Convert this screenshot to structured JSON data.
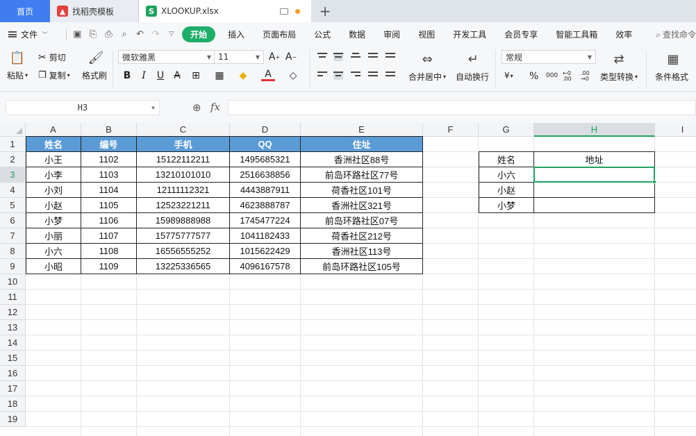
{
  "tabs": {
    "home": "首页",
    "template": "找稻壳模板",
    "file": "XLOOKUP.xlsx",
    "new_tab": "+"
  },
  "menu": {
    "file": "文件",
    "items": [
      "开始",
      "插入",
      "页面布局",
      "公式",
      "数据",
      "审阅",
      "视图",
      "开发工具",
      "会员专享",
      "智能工具箱",
      "效率"
    ],
    "search": "查找命令"
  },
  "ribbon": {
    "paste": "粘贴",
    "cut": "剪切",
    "copy": "复制",
    "format_painter": "格式刷",
    "font_name": "微软雅黑",
    "font_size": "11",
    "merge_center": "合并居中",
    "wrap_text": "自动换行",
    "number_format": "常规",
    "type_convert": "类型转换",
    "cond_format": "条件格式",
    "currency": "¥",
    "percent": "%",
    "thousands": "000",
    "inc_decimal": "←0 .00",
    "dec_decimal": ".00 →0"
  },
  "formula_bar": {
    "name_box": "H3",
    "fx": "fx",
    "value": ""
  },
  "sheet": {
    "columns": [
      "A",
      "B",
      "C",
      "D",
      "E",
      "F",
      "G",
      "H",
      "I"
    ],
    "active_column": "H",
    "rows": [
      "1",
      "2",
      "3",
      "4",
      "5",
      "6",
      "7",
      "8",
      "9",
      "10",
      "11",
      "12",
      "13",
      "14",
      "15",
      "16",
      "17",
      "18",
      "19"
    ],
    "active_row": "3",
    "table1_headers": [
      "姓名",
      "编号",
      "手机",
      "QQ",
      "住址"
    ],
    "table1_rows": [
      [
        "小王",
        "1102",
        "15122112211",
        "1495685321",
        "香洲社区88号"
      ],
      [
        "小李",
        "1103",
        "13210101010",
        "2516638856",
        "前岛环路社区77号"
      ],
      [
        "小刘",
        "1104",
        "12111112321",
        "4443887911",
        "荷香社区101号"
      ],
      [
        "小赵",
        "1105",
        "12523221211",
        "4623888787",
        "香洲社区321号"
      ],
      [
        "小梦",
        "1106",
        "15989888988",
        "1745477224",
        "前岛环路社区07号"
      ],
      [
        "小丽",
        "1107",
        "15775777577",
        "1041182433",
        "荷香社区212号"
      ],
      [
        "小六",
        "1108",
        "16556555252",
        "1015622429",
        "香洲社区113号"
      ],
      [
        "小昭",
        "1109",
        "13225336565",
        "4096167578",
        "前岛环路社区105号"
      ]
    ],
    "table2_headers": [
      "姓名",
      "地址"
    ],
    "table2_rows": [
      [
        "小六",
        ""
      ],
      [
        "小赵",
        ""
      ],
      [
        "小梦",
        ""
      ]
    ],
    "header_color": "#5b9bd5",
    "selection_color": "#1fa35d"
  }
}
